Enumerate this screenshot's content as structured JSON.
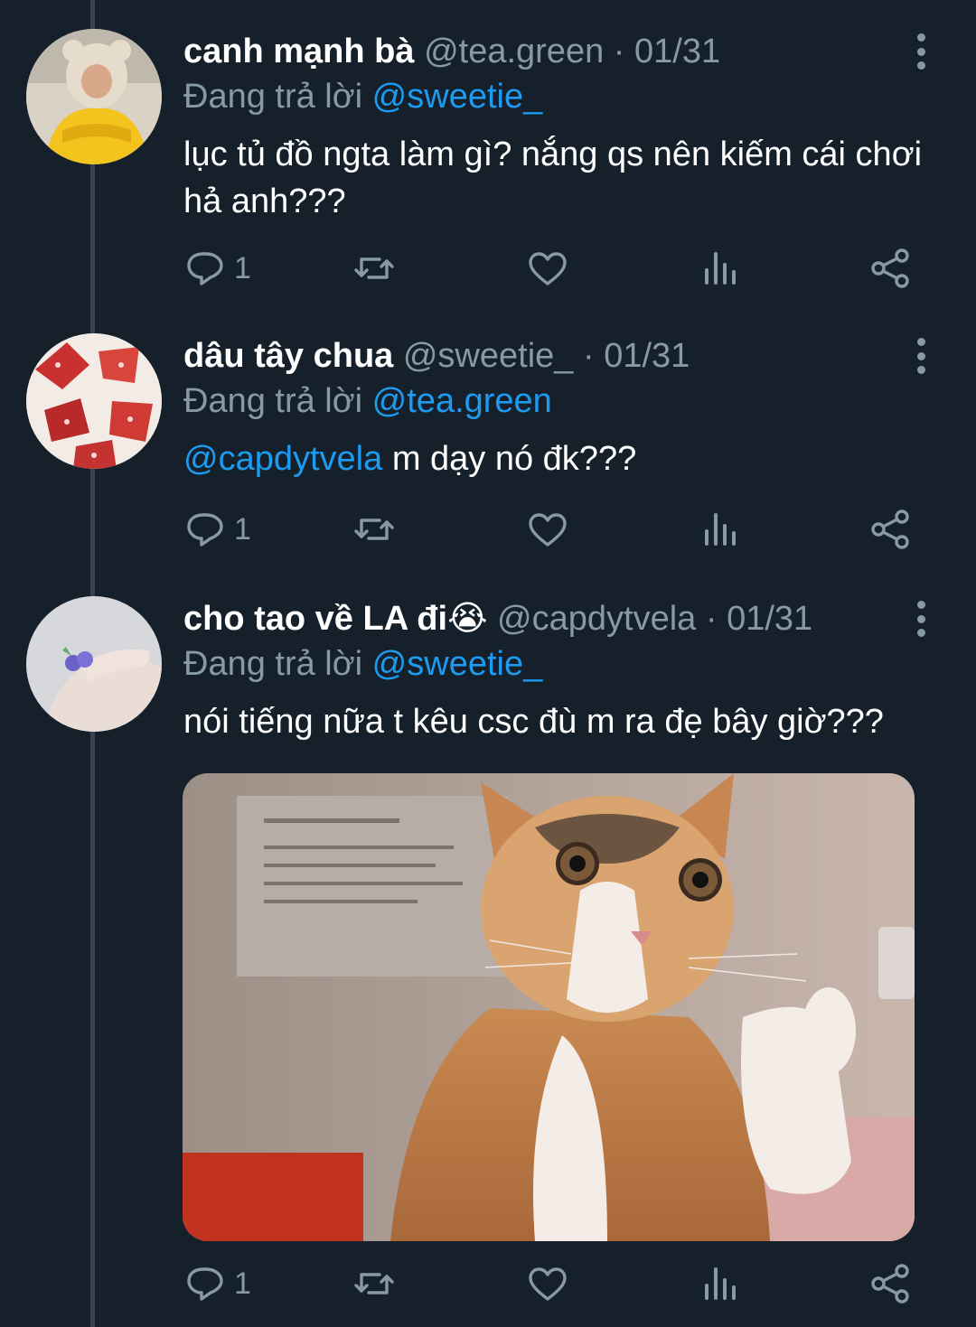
{
  "tweets": [
    {
      "name": "canh mạnh bà",
      "handle": "@tea.green",
      "sep": "·",
      "date": "01/31",
      "replying_prefix": "Đang trả lời",
      "replying_to": "@sweetie_",
      "text_mention": "",
      "text": "lục tủ đồ ngta làm gì? nắng qs nên kiếm cái chơi hả anh???",
      "reply_count": "1"
    },
    {
      "name": "dâu tây chua",
      "handle": "@sweetie_",
      "sep": "·",
      "date": "01/31",
      "replying_prefix": "Đang trả lời",
      "replying_to": "@tea.green",
      "text_mention": "@capdytvela",
      "text": "m dạy nó đk???",
      "reply_count": "1"
    },
    {
      "name": "cho tao về LA đi😭",
      "handle": "@capdytvela",
      "sep": "·",
      "date": "01/31",
      "replying_prefix": "Đang trả lời",
      "replying_to": "@sweetie_",
      "text_mention": "",
      "text": "nói tiếng nữa t kêu csc đù m ra đẹ bây giờ???",
      "reply_count": "1"
    }
  ],
  "icons": [
    "reply-icon",
    "retweet-icon",
    "like-icon",
    "analytics-icon",
    "share-icon",
    "more-icon"
  ],
  "colors": {
    "background": "#15202b",
    "accent": "#1d9bf0",
    "muted": "#8899a6",
    "text": "#ffffff"
  }
}
